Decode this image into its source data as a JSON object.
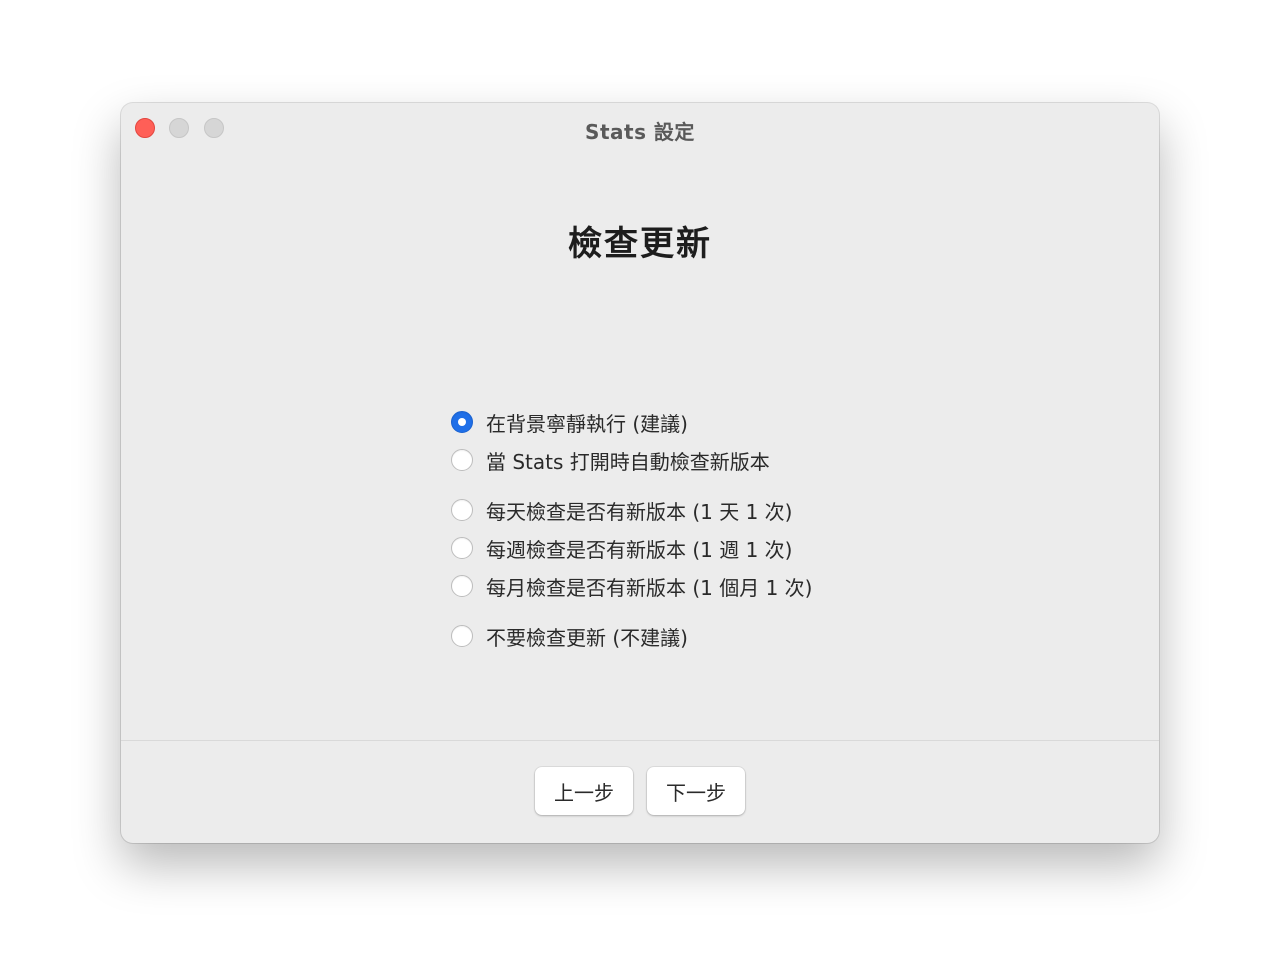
{
  "window": {
    "title": "Stats 設定"
  },
  "page": {
    "heading": "檢查更新"
  },
  "options": [
    {
      "label": "在背景寧靜執行 (建議)",
      "checked": true
    },
    {
      "label": "當 Stats 打開時自動檢查新版本",
      "checked": false
    },
    {
      "label": "每天檢查是否有新版本 (1 天 1 次)",
      "checked": false
    },
    {
      "label": "每週檢查是否有新版本 (1 週 1 次)",
      "checked": false
    },
    {
      "label": "每月檢查是否有新版本 (1 個月 1 次)",
      "checked": false
    },
    {
      "label": "不要檢查更新 (不建議)",
      "checked": false
    }
  ],
  "buttons": {
    "prev_label": "上一步",
    "next_label": "下一步"
  },
  "colors": {
    "accent": "#1f6fe8",
    "close": "#ff5f57"
  }
}
